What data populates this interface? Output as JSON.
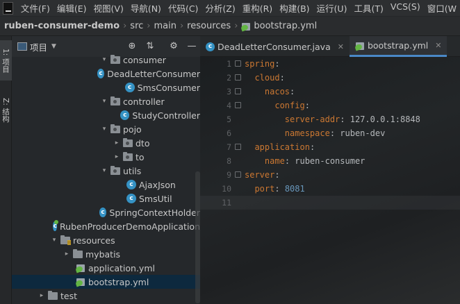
{
  "menu": [
    "文件(F)",
    "编辑(E)",
    "视图(V)",
    "导航(N)",
    "代码(C)",
    "分析(Z)",
    "重构(R)",
    "构建(B)",
    "运行(U)",
    "工具(T)",
    "VCS(S)",
    "窗口(W"
  ],
  "breadcrumb": {
    "project": "ruben-consumer-demo",
    "items": [
      "src",
      "main",
      "resources",
      "bootstrap.yml"
    ]
  },
  "toolstrip": {
    "project_tab": "1: 项目",
    "structure_tab": "Z: 结构"
  },
  "panel": {
    "title": "项目"
  },
  "tree": [
    {
      "label": "consumer",
      "type": "package",
      "arrow": "▾"
    },
    {
      "label": "DeadLetterConsumer",
      "type": "class"
    },
    {
      "label": "SmsConsumer",
      "type": "class"
    },
    {
      "label": "controller",
      "type": "package",
      "arrow": "▾"
    },
    {
      "label": "StudyController",
      "type": "class"
    },
    {
      "label": "pojo",
      "type": "package",
      "arrow": "▾"
    },
    {
      "label": "dto",
      "type": "package",
      "arrow": "▸"
    },
    {
      "label": "to",
      "type": "package",
      "arrow": "▸"
    },
    {
      "label": "utils",
      "type": "package",
      "arrow": "▾"
    },
    {
      "label": "AjaxJson",
      "type": "class"
    },
    {
      "label": "SmsUtil",
      "type": "class"
    },
    {
      "label": "SpringContextHolder",
      "type": "class"
    },
    {
      "label": "RubenProducerDemoApplication",
      "type": "boot"
    },
    {
      "label": "resources",
      "type": "resources",
      "arrow": "▾"
    },
    {
      "label": "mybatis",
      "type": "folder",
      "arrow": "▸"
    },
    {
      "label": "application.yml",
      "type": "yml"
    },
    {
      "label": "bootstrap.yml",
      "type": "yml",
      "selected": true
    },
    {
      "label": "test",
      "type": "folder",
      "arrow": "▸"
    }
  ],
  "tabs": [
    {
      "label": "DeadLetterConsumer.java",
      "active": false
    },
    {
      "label": "bootstrap.yml",
      "active": true
    }
  ],
  "code": [
    {
      "n": "1",
      "parts": [
        [
          "key",
          "spring"
        ],
        [
          "val",
          ":"
        ]
      ]
    },
    {
      "n": "2",
      "parts": [
        [
          "val",
          "  "
        ],
        [
          "key",
          "cloud"
        ],
        [
          "val",
          ":"
        ]
      ]
    },
    {
      "n": "3",
      "parts": [
        [
          "val",
          "    "
        ],
        [
          "key",
          "nacos"
        ],
        [
          "val",
          ":"
        ]
      ]
    },
    {
      "n": "4",
      "parts": [
        [
          "val",
          "      "
        ],
        [
          "key",
          "config"
        ],
        [
          "val",
          ":"
        ]
      ]
    },
    {
      "n": "5",
      "parts": [
        [
          "val",
          "        "
        ],
        [
          "key",
          "server-addr"
        ],
        [
          "val",
          ": 127.0.0.1:8848"
        ]
      ]
    },
    {
      "n": "6",
      "parts": [
        [
          "val",
          "        "
        ],
        [
          "key",
          "namespace"
        ],
        [
          "val",
          ": ruben-dev"
        ]
      ]
    },
    {
      "n": "7",
      "parts": [
        [
          "val",
          "  "
        ],
        [
          "key",
          "application"
        ],
        [
          "val",
          ":"
        ]
      ]
    },
    {
      "n": "8",
      "parts": [
        [
          "val",
          "    "
        ],
        [
          "key",
          "name"
        ],
        [
          "val",
          ": ruben-consumer"
        ]
      ]
    },
    {
      "n": "9",
      "parts": [
        [
          "key",
          "server"
        ],
        [
          "val",
          ":"
        ]
      ]
    },
    {
      "n": "10",
      "parts": [
        [
          "val",
          "  "
        ],
        [
          "key",
          "port"
        ],
        [
          "val",
          ": "
        ],
        [
          "num",
          "8081"
        ]
      ]
    },
    {
      "n": "11",
      "parts": []
    }
  ],
  "colors": {
    "keyword": "#cc7832",
    "number": "#6897bb",
    "selection": "#0d293e",
    "active_tab_underline": "#4a88c7"
  }
}
